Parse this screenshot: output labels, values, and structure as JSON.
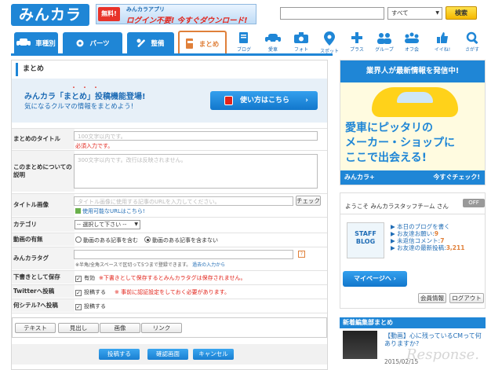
{
  "header": {
    "logo": "みんカラ",
    "banner": {
      "free": "無料!",
      "app": "みんカラアプリ",
      "text": "ログイン不要! 今すぐダウンロード!"
    },
    "search_value": "",
    "search_scope": "すべて",
    "search_button": "検索"
  },
  "tabs": [
    {
      "label": "車種別",
      "icon": "car-icon"
    },
    {
      "label": "パーツ",
      "icon": "gear-icon"
    },
    {
      "label": "整備",
      "icon": "wrench-icon"
    },
    {
      "label": "まとめ",
      "icon": "matome-icon"
    }
  ],
  "nav_icons": [
    {
      "label": "ブログ",
      "icon": "blog-icon"
    },
    {
      "label": "愛車",
      "icon": "car-icon"
    },
    {
      "label": "フォト",
      "icon": "camera-icon"
    },
    {
      "label": "スポット",
      "icon": "pin-icon"
    },
    {
      "label": "プラス",
      "icon": "plus-icon"
    },
    {
      "label": "グループ",
      "icon": "group-icon"
    },
    {
      "label": "オフ会",
      "icon": "off-icon"
    },
    {
      "label": "イイね!",
      "icon": "thumb-icon"
    },
    {
      "label": "さがす",
      "icon": "search-icon"
    }
  ],
  "main": {
    "title": "まとめ",
    "promo_line1": "みんカラ「まとめ」投稿機能登場!",
    "promo_dots": "・・・",
    "promo_line2": "気になるクルマの情報をまとめよう!",
    "howto_button": "使い方はこちら",
    "form": {
      "title_label": "まとめのタイトル",
      "title_placeholder": "100文字以内です。",
      "title_required": "必須入力です。",
      "desc_label": "このまとめについての説明",
      "desc_placeholder": "300文字以内です。改行は反映されません。",
      "image_label": "タイトル画像",
      "image_placeholder": "タイトル画像に使用する記事のURLを入力してください。",
      "check_button": "チェック",
      "image_help": "使用可能なURLはこちら!",
      "category_label": "カテゴリ",
      "category_value": "-- 選択して下さい --",
      "video_label": "動画の有無",
      "video_opt1": "動画のある記事を含む",
      "video_opt2": "動画のある記事を含まない",
      "tag_label": "みんカラタグ",
      "tag_note": "※半角/全角スペースで区切って5つまで登録できます。",
      "tag_link": "過去の入力から",
      "draft_label": "下書きとして保存",
      "draft_value": "有効",
      "draft_note": "※下書きとして保存するとみんカラタグは保存されません。",
      "twitter_label": "Twitterへ投稿",
      "twitter_value": "投稿する",
      "twitter_note": "※ 事前に認証設定をしておく必要があります。",
      "nanshiteru_label": "何シテル?へ投稿",
      "nanshiteru_value": "投稿する"
    },
    "toolbar": [
      "テキスト",
      "見出し",
      "画像",
      "リンク"
    ],
    "actions": {
      "submit": "投稿する",
      "confirm": "確認画面",
      "cancel": "キャンセル"
    }
  },
  "sidebar": {
    "ad": {
      "top": "業界人が最新情報を発信中!",
      "line1": "愛車にピッタリの",
      "line2": "メーカー・ショップに",
      "line3": "ここで出会える!",
      "bar_left": "みんカラ+",
      "bar_right": "今すぐチェック!"
    },
    "welcome": "ようこそ みんカラスタッフチーム さん",
    "off_badge": "OFF",
    "staff_blog": "STAFF BLOG",
    "stats": [
      {
        "label": "本日のブログを書く",
        "value": ""
      },
      {
        "label": "お友達お願い:",
        "value": "9"
      },
      {
        "label": "未返信コメント:",
        "value": "7"
      },
      {
        "label": "お友達の最新投稿:",
        "value": "3,211"
      }
    ],
    "mypage_button": "マイページへ",
    "member_button": "会員情報",
    "logout_button": "ログアウト",
    "news_head": "新着編集部まとめ",
    "news_title": "【動画】心に残っているCMって何ありますか?",
    "news_date": "2015/02/15",
    "watermark": "Response."
  },
  "colors": {
    "brand_blue": "#1f86d6",
    "accent_orange": "#e0803a",
    "alert_red": "#e2231a"
  }
}
